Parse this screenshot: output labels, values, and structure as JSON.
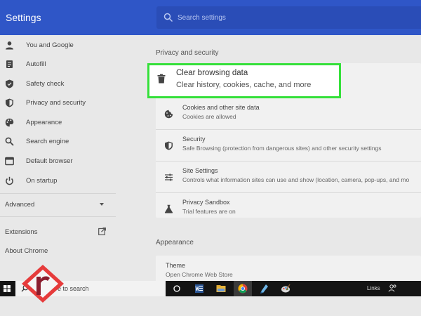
{
  "header": {
    "title": "Settings",
    "search_placeholder": "Search settings",
    "color": "#2f56c7"
  },
  "sidebar": {
    "items": [
      {
        "label": "You and Google",
        "icon": "person-icon"
      },
      {
        "label": "Autofill",
        "icon": "autofill-icon"
      },
      {
        "label": "Safety check",
        "icon": "shield-check-icon"
      },
      {
        "label": "Privacy and security",
        "icon": "privacy-shield-icon"
      },
      {
        "label": "Appearance",
        "icon": "palette-icon"
      },
      {
        "label": "Search engine",
        "icon": "search-icon"
      },
      {
        "label": "Default browser",
        "icon": "browser-icon"
      },
      {
        "label": "On startup",
        "icon": "power-icon"
      }
    ],
    "advanced_label": "Advanced",
    "extensions_label": "Extensions",
    "about_label": "About Chrome"
  },
  "main": {
    "privacy_section_title": "Privacy and security",
    "clear_browsing": {
      "title": "Clear browsing data",
      "subtitle": "Clear history, cookies, cache, and more",
      "highlight_color": "#35e03a"
    },
    "privacy_rows": [
      {
        "title": "Cookies and other site data",
        "subtitle": "Cookies are allowed",
        "icon": "cookie-icon"
      },
      {
        "title": "Security",
        "subtitle": "Safe Browsing (protection from dangerous sites) and other security settings",
        "icon": "security-shield-icon"
      },
      {
        "title": "Site Settings",
        "subtitle": "Controls what information sites can use and show (location, camera, pop-ups, and mo",
        "icon": "sliders-icon"
      },
      {
        "title": "Privacy Sandbox",
        "subtitle": "Trial features are on",
        "icon": "flask-icon"
      }
    ],
    "appearance_section_title": "Appearance",
    "appearance_rows": [
      {
        "title": "Theme",
        "subtitle": "Open Chrome Web Store"
      }
    ]
  },
  "taskbar": {
    "search_text": "e to search",
    "links_label": "Links",
    "apps": [
      "task-view-icon",
      "word-icon",
      "file-explorer-icon",
      "chrome-icon",
      "app-icon",
      "paint-icon"
    ]
  }
}
